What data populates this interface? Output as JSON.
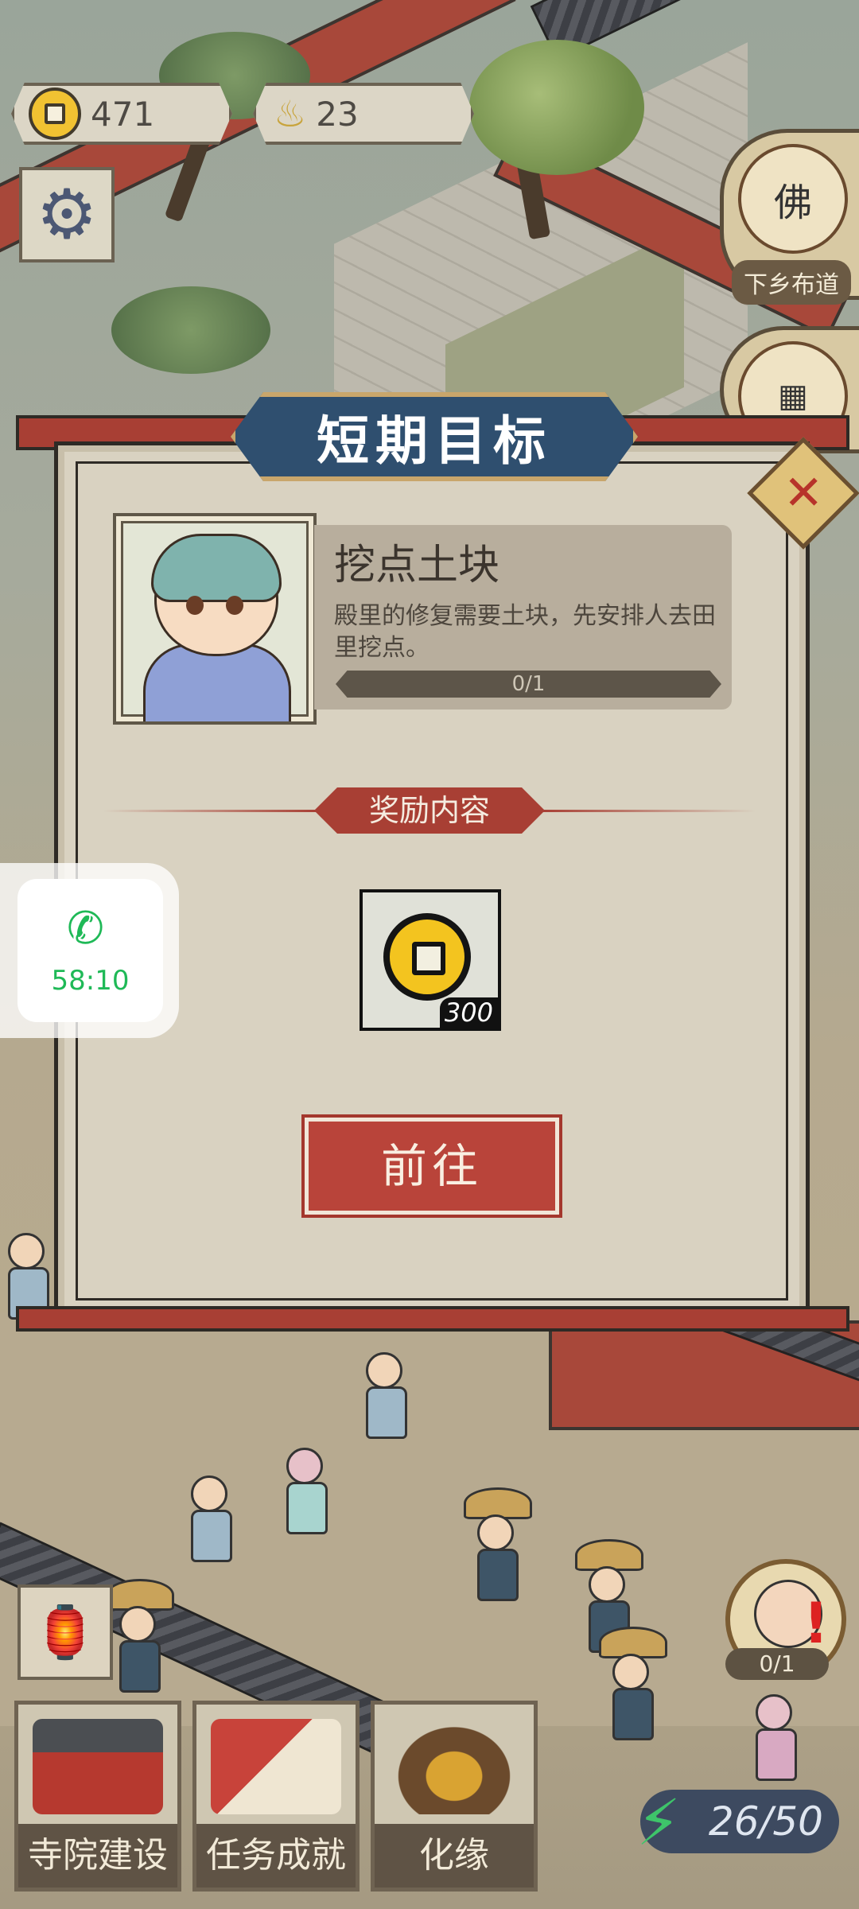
{
  "hud": {
    "coins": "471",
    "incense": "23",
    "settings_icon": "gear-icon"
  },
  "side_buttons": {
    "buddha_char": "佛",
    "buddha_label": "下乡布道"
  },
  "modal": {
    "title": "短期目标",
    "close_icon": "close-icon",
    "quest": {
      "name": "挖点土块",
      "description": "殿里的修复需要土块，先安排人去田里挖点。",
      "progress": "0/1"
    },
    "reward_header": "奖励内容",
    "reward": {
      "icon": "copper-coin-icon",
      "quantity": "300"
    },
    "go_button": "前往"
  },
  "call_widget": {
    "icon": "phone-icon",
    "time": "58:10",
    "color": "#1fb957"
  },
  "bottom_bar": {
    "buttons": [
      {
        "label": "寺院建设",
        "icon": "temple-icon"
      },
      {
        "label": "任务成就",
        "icon": "scroll-book-icon"
      },
      {
        "label": "化缘",
        "icon": "alms-bowl-icon"
      }
    ],
    "energy": "26/50",
    "monk_count": "0/1"
  },
  "colors": {
    "accent_red": "#a83f34",
    "title_blue": "#2f4f6f",
    "parchment": "#d9d2c1"
  }
}
